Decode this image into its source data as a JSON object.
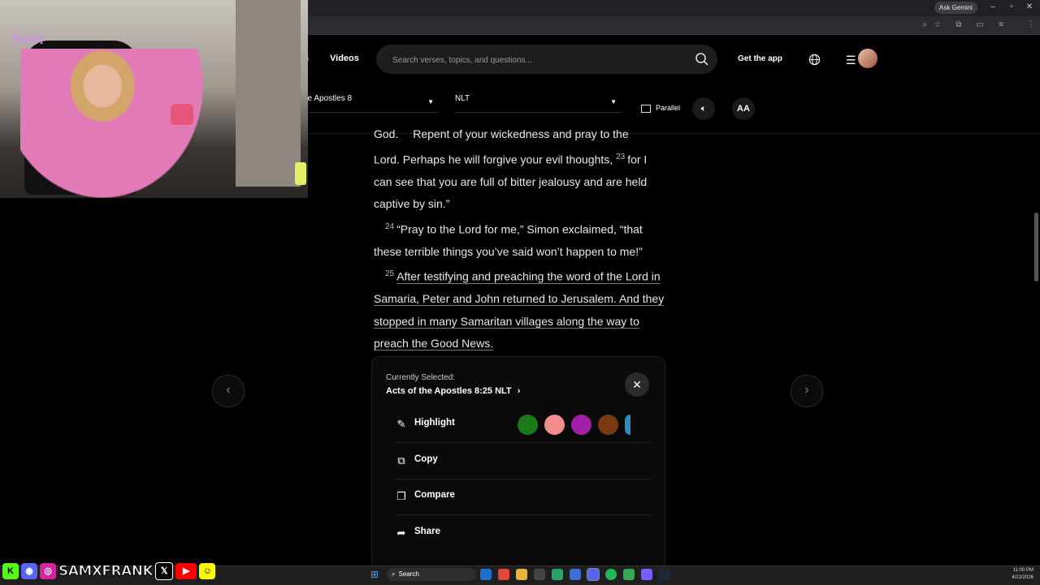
{
  "browser": {
    "ask_gemini": "Ask Gemini",
    "window_controls": [
      "–",
      "▫",
      "✕"
    ]
  },
  "header": {
    "nav_partial": "s",
    "nav_videos": "Videos",
    "search_placeholder": "Search verses, topics, and questions...",
    "get_app": "Get the app"
  },
  "toolbar": {
    "book": "he Apostles 8",
    "version": "NLT",
    "parallel": "Parallel",
    "font_size": "AA"
  },
  "verses": {
    "line0": "God.",
    "line0b": "Repent of your wickedness and pray to the",
    "v22_cont": "Lord. Perhaps he will forgive your evil thoughts,",
    "v23_num": "23",
    "v23_text": "for I can see that you are full of bitter jealousy and are held captive by sin.”",
    "v24_num": "24",
    "v24_text": "“Pray to the Lord for me,” Simon exclaimed, “that these terrible things you’ve said won’t happen to me!”",
    "v25_num": "25",
    "v25_text": "After testifying and preaching the word of the Lord in Samaria, Peter and John returned to Jerusalem. And they stopped in many Samaritan villages along the way to preach the Good News."
  },
  "popup": {
    "currently_selected": "Currently Selected:",
    "reference": "Acts of the Apostles 8:25 NLT",
    "actions": {
      "highlight": "Highlight",
      "copy": "Copy",
      "compare": "Compare",
      "share": "Share"
    },
    "swatch_colors": [
      "#1a7a1a",
      "#f28b8b",
      "#a11fa6",
      "#7a3a10",
      "#2a8fbf"
    ]
  },
  "stream": {
    "webcam_logo": "Sam",
    "handle": "SAMXFRANK"
  },
  "taskbar": {
    "search": "Search",
    "time": "11:00 PM",
    "date": "4/22/2026"
  }
}
